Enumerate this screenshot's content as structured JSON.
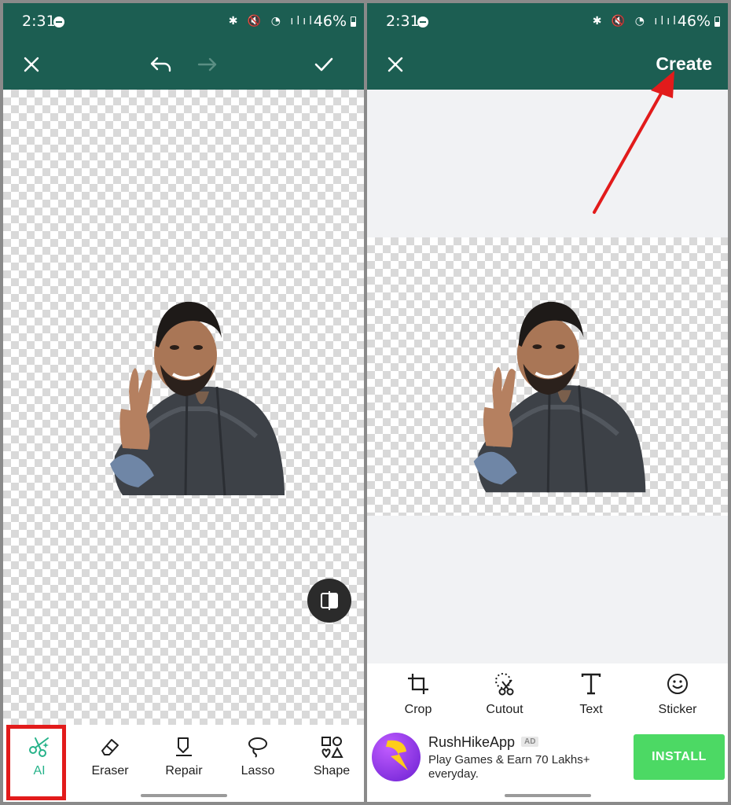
{
  "status_bar": {
    "time": "2:31",
    "icons": "✱ 🔇 ◔ ılıl",
    "battery": "46%"
  },
  "left_screen": {
    "toolbar": {
      "close_icon": "close-icon",
      "undo_icon": "undo-icon",
      "redo_icon": "redo-icon",
      "done_icon": "check-icon"
    },
    "tools": [
      {
        "label": "AI",
        "icon": "ai-scissors-icon",
        "active": true
      },
      {
        "label": "Eraser",
        "icon": "eraser-icon"
      },
      {
        "label": "Repair",
        "icon": "repair-icon"
      },
      {
        "label": "Lasso",
        "icon": "lasso-icon"
      },
      {
        "label": "Shape",
        "icon": "shape-icon"
      }
    ]
  },
  "right_screen": {
    "toolbar": {
      "close_icon": "close-icon",
      "create_label": "Create"
    },
    "tools": [
      {
        "label": "Crop",
        "icon": "crop-icon"
      },
      {
        "label": "Cutout",
        "icon": "cutout-icon"
      },
      {
        "label": "Text",
        "icon": "text-icon"
      },
      {
        "label": "Sticker",
        "icon": "smiley-icon"
      }
    ],
    "ad": {
      "title": "RushHikeApp",
      "badge": "AD",
      "description": "Play Games & Earn 70 Lakhs+ everyday.",
      "button": "INSTALL"
    }
  },
  "colors": {
    "header": "#1c5e52",
    "accent": "#27b38a",
    "highlight": "#e21b1b",
    "install": "#4cd964"
  }
}
